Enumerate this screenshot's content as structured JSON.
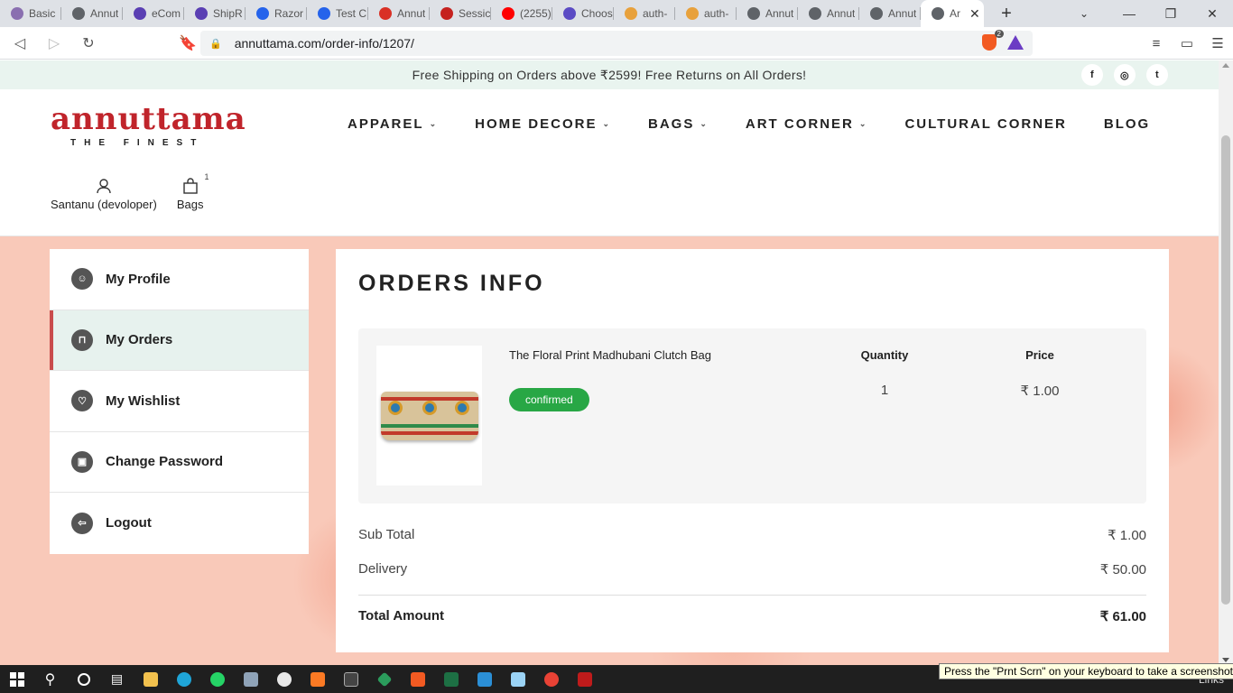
{
  "browser": {
    "tabs": [
      {
        "label": "Basic",
        "color": "#8a6fb0"
      },
      {
        "label": "Annut",
        "color": "#5f6368"
      },
      {
        "label": "eCom",
        "color": "#5a3fb3"
      },
      {
        "label": "ShipR",
        "color": "#5a3fb3"
      },
      {
        "label": "Razor",
        "color": "#2563eb"
      },
      {
        "label": "Test C",
        "color": "#2563eb"
      },
      {
        "label": "Annut",
        "color": "#d93025"
      },
      {
        "label": "Sessic",
        "color": "#c5221f"
      },
      {
        "label": "(2255)",
        "color": "#ff0000"
      },
      {
        "label": "Choos",
        "color": "#5b4bc4"
      },
      {
        "label": "auth-",
        "color": "#e8a13c"
      },
      {
        "label": "auth-",
        "color": "#e8a13c"
      },
      {
        "label": "Annut",
        "color": "#5f6368"
      },
      {
        "label": "Annut",
        "color": "#5f6368"
      },
      {
        "label": "Annut",
        "color": "#5f6368"
      }
    ],
    "active_tab": {
      "label": "Ar",
      "color": "#5f6368"
    },
    "url": "annuttama.com/order-info/1207/",
    "shield_count": "2"
  },
  "announcement": "Free Shipping on Orders above ₹2599! Free Returns on All Orders!",
  "socials": [
    {
      "icon": "facebook-icon",
      "glyph": "f"
    },
    {
      "icon": "instagram-icon",
      "glyph": "◎"
    },
    {
      "icon": "twitter-icon",
      "glyph": "t"
    }
  ],
  "logo": {
    "name": "annuttama",
    "tagline": "THE FINEST"
  },
  "nav": [
    {
      "label": "APPAREL",
      "has_menu": true
    },
    {
      "label": "HOME DECORE",
      "has_menu": true
    },
    {
      "label": "BAGS",
      "has_menu": true
    },
    {
      "label": "ART CORNER",
      "has_menu": true
    },
    {
      "label": "CULTURAL CORNER",
      "has_menu": false
    },
    {
      "label": "BLOG",
      "has_menu": false
    }
  ],
  "user": {
    "name": "Santanu (devoloper)",
    "bags_label": "Bags",
    "bag_count": "1"
  },
  "sidebar": {
    "items": [
      {
        "label": "My Profile",
        "icon": "user-icon",
        "glyph": "☺",
        "active": false
      },
      {
        "label": "My Orders",
        "icon": "bag-icon",
        "glyph": "⊓",
        "active": true
      },
      {
        "label": "My Wishlist",
        "icon": "heart-icon",
        "glyph": "♡",
        "active": false
      },
      {
        "label": "Change Password",
        "icon": "lock-icon",
        "glyph": "▣",
        "active": false
      },
      {
        "label": "Logout",
        "icon": "logout-icon",
        "glyph": "⇦",
        "active": false
      }
    ]
  },
  "order": {
    "title": "ORDERS INFO",
    "product_name": "The Floral Print Madhubani Clutch Bag",
    "status": "confirmed",
    "quantity_label": "Quantity",
    "price_label": "Price",
    "quantity": "1",
    "price": "₹ 1.00",
    "sub_total_label": "Sub Total",
    "sub_total": "₹ 1.00",
    "delivery_label": "Delivery",
    "delivery": "₹ 50.00",
    "total_label": "Total Amount",
    "total": "₹ 61.00"
  },
  "taskbar": {
    "links_label": "Links",
    "tooltip": "Press the \"Prnt Scrn\" on your keyboard to take a screenshot"
  },
  "colors": {
    "accent": "#c94c4c",
    "status_green": "#28a745",
    "brand_red": "#c0242b"
  }
}
